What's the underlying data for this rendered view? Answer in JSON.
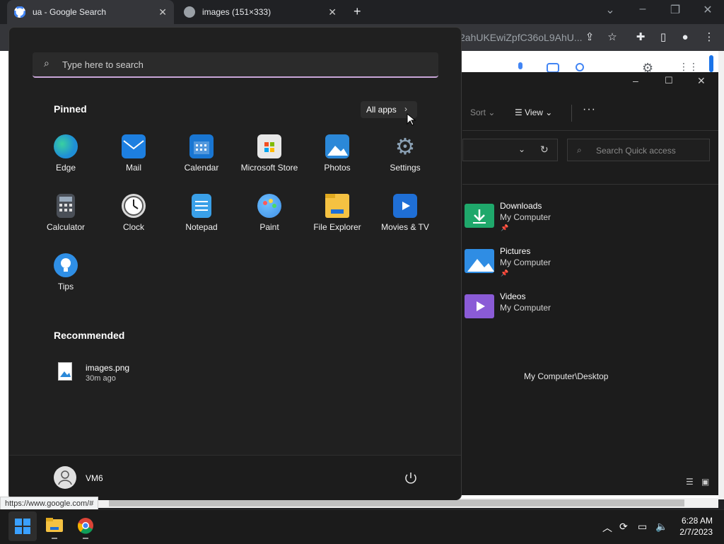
{
  "browser": {
    "tabs": [
      {
        "title": "ua - Google Search",
        "active": true
      },
      {
        "title": "images (151×333)",
        "active": false
      }
    ],
    "new_tab": "+",
    "address_fragment": "2ahUKEwiZpfC36oL9AhU...",
    "status_url": "https://www.google.com/#"
  },
  "explorer": {
    "toolbar": {
      "sort_label": "Sort",
      "view_label": "View",
      "more_label": "···"
    },
    "search_placeholder": "Search Quick access",
    "quick_access": [
      {
        "name": "Downloads",
        "location": "My Computer",
        "pinned": true,
        "color": "#1fa86b"
      },
      {
        "name": "Pictures",
        "location": "My Computer",
        "pinned": true,
        "color": "#2f8de4"
      },
      {
        "name": "Videos",
        "location": "My Computer",
        "pinned": false,
        "color": "#8a5bd6"
      }
    ],
    "status_path": "My Computer\\Desktop"
  },
  "start_menu": {
    "search_placeholder": "Type here to search",
    "pinned_title": "Pinned",
    "all_apps_label": "All apps",
    "pinned_apps": [
      {
        "label": "Edge",
        "icon": "edge-icon",
        "color": "#1f8fd6"
      },
      {
        "label": "Mail",
        "icon": "mail-icon",
        "color": "#1d7fe0"
      },
      {
        "label": "Calendar",
        "icon": "calendar-icon",
        "color": "#1976d2"
      },
      {
        "label": "Microsoft Store",
        "icon": "store-icon",
        "color": "#e8e8e8"
      },
      {
        "label": "Photos",
        "icon": "photos-icon",
        "color": "#2b88d8"
      },
      {
        "label": "Settings",
        "icon": "gear-icon",
        "color": "#6e7a86"
      },
      {
        "label": "Calculator",
        "icon": "calculator-icon",
        "color": "#4a4f57"
      },
      {
        "label": "Clock",
        "icon": "clock-icon",
        "color": "#d9d9d9"
      },
      {
        "label": "Notepad",
        "icon": "notepad-icon",
        "color": "#3aa0e8"
      },
      {
        "label": "Paint",
        "icon": "paint-icon",
        "color": "#3f8fe6"
      },
      {
        "label": "File Explorer",
        "icon": "folder-icon",
        "color": "#f5c242"
      },
      {
        "label": "Movies & TV",
        "icon": "movies-icon",
        "color": "#1f6fd6"
      },
      {
        "label": "Tips",
        "icon": "tips-icon",
        "color": "#2f8fe6"
      }
    ],
    "recommended_title": "Recommended",
    "recommended": [
      {
        "name": "images.png",
        "time": "30m ago"
      }
    ],
    "user_name": "VM6"
  },
  "taskbar": {
    "clock_time": "6:28 AM",
    "clock_date": "2/7/2023"
  }
}
